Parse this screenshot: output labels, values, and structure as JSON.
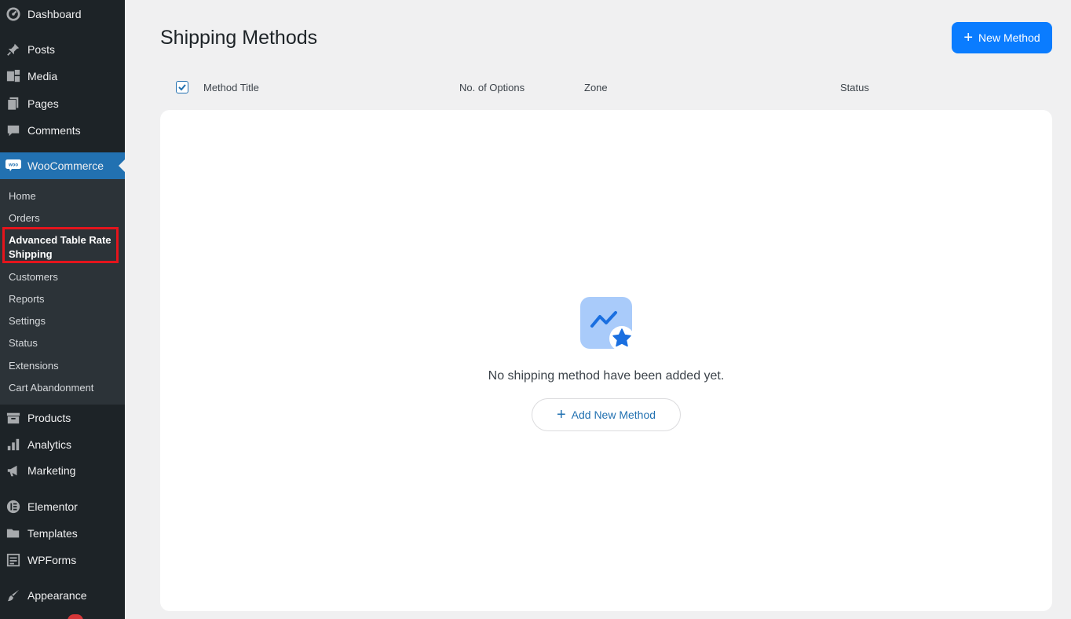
{
  "sidebar": {
    "top_items": [
      {
        "label": "Dashboard",
        "icon": "dashboard-icon"
      },
      {
        "label": "Posts",
        "icon": "pin-icon"
      },
      {
        "label": "Media",
        "icon": "media-icon"
      },
      {
        "label": "Pages",
        "icon": "pages-icon"
      },
      {
        "label": "Comments",
        "icon": "comment-icon"
      }
    ],
    "active_item": {
      "label": "WooCommerce",
      "icon": "woo-icon"
    },
    "submenu": [
      {
        "label": "Home"
      },
      {
        "label": "Orders"
      },
      {
        "label": "Advanced Table Rate Shipping"
      },
      {
        "label": "Customers"
      },
      {
        "label": "Reports"
      },
      {
        "label": "Settings"
      },
      {
        "label": "Status"
      },
      {
        "label": "Extensions"
      },
      {
        "label": "Cart Abandonment"
      }
    ],
    "bottom_items": [
      {
        "label": "Products",
        "icon": "archive-icon"
      },
      {
        "label": "Analytics",
        "icon": "bar-chart-icon"
      },
      {
        "label": "Marketing",
        "icon": "megaphone-icon"
      },
      {
        "label": "Elementor",
        "icon": "elementor-icon"
      },
      {
        "label": "Templates",
        "icon": "folder-icon"
      },
      {
        "label": "WPForms",
        "icon": "forms-icon"
      },
      {
        "label": "Appearance",
        "icon": "brush-icon"
      }
    ]
  },
  "header": {
    "title": "Shipping Methods",
    "new_button_label": "New Method"
  },
  "table": {
    "columns": [
      "Method Title",
      "No. of Options",
      "Zone",
      "Status"
    ],
    "select_all_checked": true
  },
  "empty_state": {
    "message": "No shipping method have been added yet.",
    "button_label": "Add New Method"
  },
  "colors": {
    "sidebar_bg": "#1d2327",
    "submenu_bg": "#2c3338",
    "active_bg": "#2271b1",
    "primary_button": "#0a7cff",
    "highlight_border": "#e5141c"
  }
}
